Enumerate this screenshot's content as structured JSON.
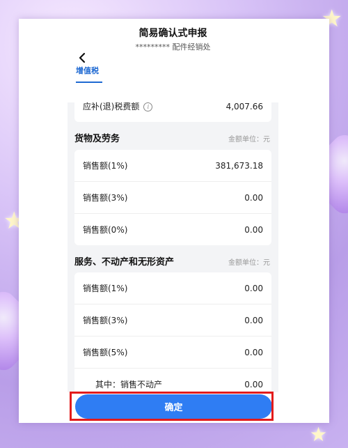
{
  "header": {
    "title": "简易确认式申报",
    "subtitle": "********* 配件经销处"
  },
  "tabs": [
    {
      "label": "增值税",
      "active": true
    }
  ],
  "summary": {
    "label": "应补(退)税费额",
    "value": "4,007.66"
  },
  "goods_section": {
    "title": "货物及劳务",
    "unit": "金额单位：元",
    "rows": [
      {
        "label": "销售额(1%)",
        "value": "381,673.18"
      },
      {
        "label": "销售额(3%)",
        "value": "0.00"
      },
      {
        "label": "销售额(0%)",
        "value": "0.00"
      }
    ]
  },
  "services_section": {
    "title": "服务、不动产和无形资产",
    "unit": "金额单位：元",
    "rows": [
      {
        "label": "销售额(1%)",
        "value": "0.00"
      },
      {
        "label": "销售额(3%)",
        "value": "0.00"
      },
      {
        "label": "销售额(5%)",
        "value": "0.00"
      },
      {
        "label": "其中：销售不动产",
        "value": "0.00"
      }
    ]
  },
  "confirm_button": "确定",
  "colors": {
    "accent": "#2f7df3",
    "tab_active": "#1e69d2",
    "highlight": "#e31b1b"
  },
  "icons": {
    "back": "chevron-left-icon",
    "info": "info-icon"
  }
}
